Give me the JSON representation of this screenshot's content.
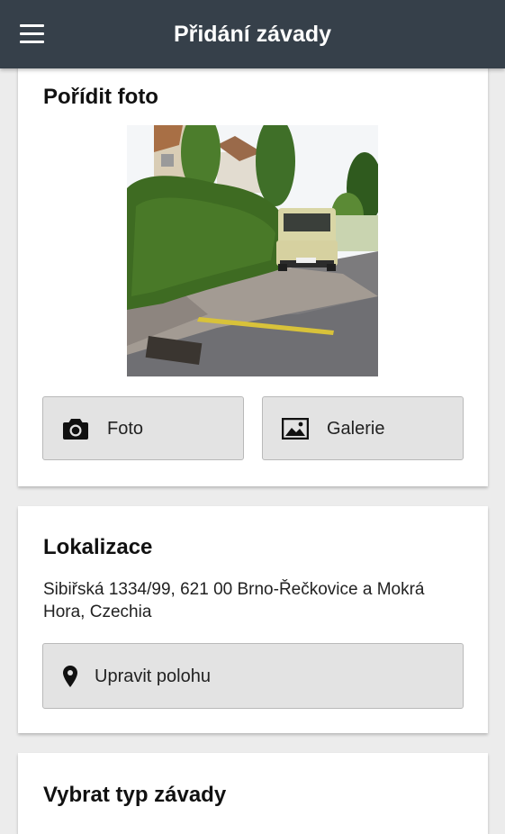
{
  "app_bar": {
    "title": "Přidání závady",
    "menu_icon": "hamburger-menu-icon"
  },
  "photo_section": {
    "title": "Pořídit foto",
    "photo_description": "street photo with hedge and parked yellow van",
    "buttons": [
      {
        "label": "Foto",
        "icon": "camera-icon"
      },
      {
        "label": "Galerie",
        "icon": "image-gallery-icon"
      }
    ]
  },
  "location_section": {
    "title": "Lokalizace",
    "address": "Sibiřská 1334/99, 621 00 Brno-Řečkovice a Mokrá Hora, Czechia",
    "edit_button": {
      "label": "Upravit polohu",
      "icon": "map-marker-icon"
    }
  },
  "type_section": {
    "title": "Vybrat typ závady"
  },
  "colors": {
    "app_bar": "#36404a",
    "background": "#ececec",
    "card": "#ffffff",
    "button": "#e3e3e3"
  }
}
